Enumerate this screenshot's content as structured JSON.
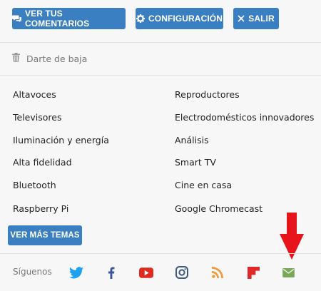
{
  "top_buttons": {
    "comments_label": "VER TUS COMENTARIOS",
    "config_label": "CONFIGURACIÓN",
    "logout_label": "SALIR"
  },
  "unsubscribe_label": "Darte de baja",
  "topics_left": [
    "Altavoces",
    "Televisores",
    "Iluminación y energía",
    "Alta fidelidad",
    "Bluetooth",
    "Raspberry Pi"
  ],
  "topics_right": [
    "Reproductores",
    "Electrodomésticos innovadores",
    "Análisis",
    "Smart TV",
    "Cine en casa",
    "Google Chromecast"
  ],
  "more_topics_label": "VER MÁS TEMAS",
  "follow_label": "Síguenos",
  "social_icons": [
    "twitter-icon",
    "facebook-icon",
    "youtube-icon",
    "instagram-icon",
    "rss-icon",
    "flipboard-icon",
    "email-icon"
  ],
  "colors": {
    "button_blue": "#3a7fc1",
    "twitter": "#1da1f2",
    "facebook": "#3b5998",
    "youtube": "#e02a20",
    "instagram": "#3d5a80",
    "rss": "#f29a3b",
    "flipboard": "#e12828",
    "email": "#7aa856",
    "arrow": "#e8141b"
  }
}
